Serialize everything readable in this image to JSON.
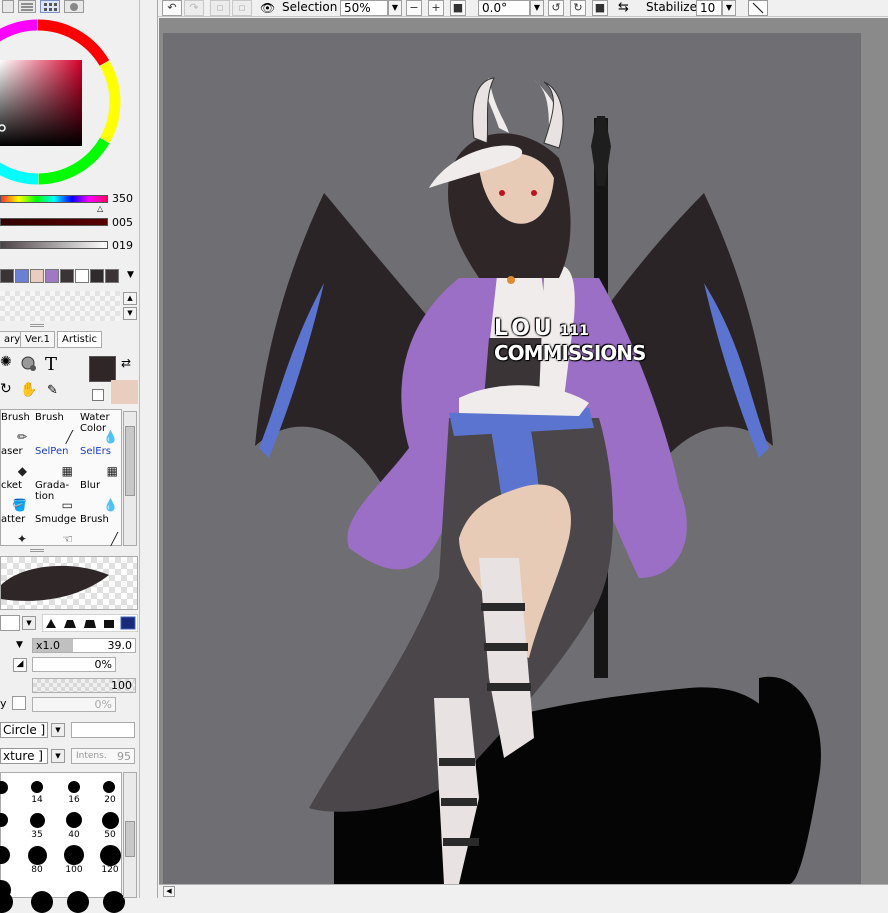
{
  "toolbar": {
    "selection_label": "Selection",
    "zoom_value": "50%",
    "rotation_value": "0.0°",
    "stabilizer_label": "Stabilizer",
    "stabilizer_value": "10"
  },
  "color_panel": {
    "slider_values": [
      "350",
      "005",
      "019"
    ],
    "swatch_colors": [
      "#3a3437",
      "#6b7fd4",
      "#e9cdbf",
      "#a079c4",
      "#3a3437",
      "#ffffff",
      "#2f2a2c",
      "#3a3437"
    ],
    "primary_color": "#2f2628",
    "secondary_color": "#e9cdbf"
  },
  "tool_tabs": [
    "ary",
    "Ver.1",
    "Artistic"
  ],
  "tools": [
    {
      "label": "Brush",
      "blue": false
    },
    {
      "label": "Brush",
      "blue": false
    },
    {
      "label": "Water Color",
      "blue": false
    },
    {
      "label": "aser",
      "blue": false
    },
    {
      "label": "SelPen",
      "blue": true
    },
    {
      "label": "SelErs",
      "blue": true
    },
    {
      "label": "cket",
      "blue": false
    },
    {
      "label": "Grada- tion",
      "blue": false
    },
    {
      "label": "Blur",
      "blue": false
    },
    {
      "label": "atter",
      "blue": false
    },
    {
      "label": "Smudge",
      "blue": false
    },
    {
      "label": "Brush",
      "blue": false
    }
  ],
  "brush_settings": {
    "size_multiplier": "x1.0",
    "size_value": "39.0",
    "min_size": "0%",
    "density": "100",
    "partial_label": "y",
    "partial_value": "0%",
    "shape_dropdown": "Circle ]",
    "texture_dropdown": "xture ]",
    "intensity_label": "Intens.",
    "intensity_value": "95"
  },
  "brush_sizes": [
    "14",
    "16",
    "20",
    "35",
    "40",
    "50",
    "80",
    "100",
    "120"
  ],
  "canvas": {
    "background_color": "#6f6f73",
    "watermark_line1": "LOU",
    "watermark_num": "111",
    "watermark_line2": "COMMISSIONS"
  }
}
